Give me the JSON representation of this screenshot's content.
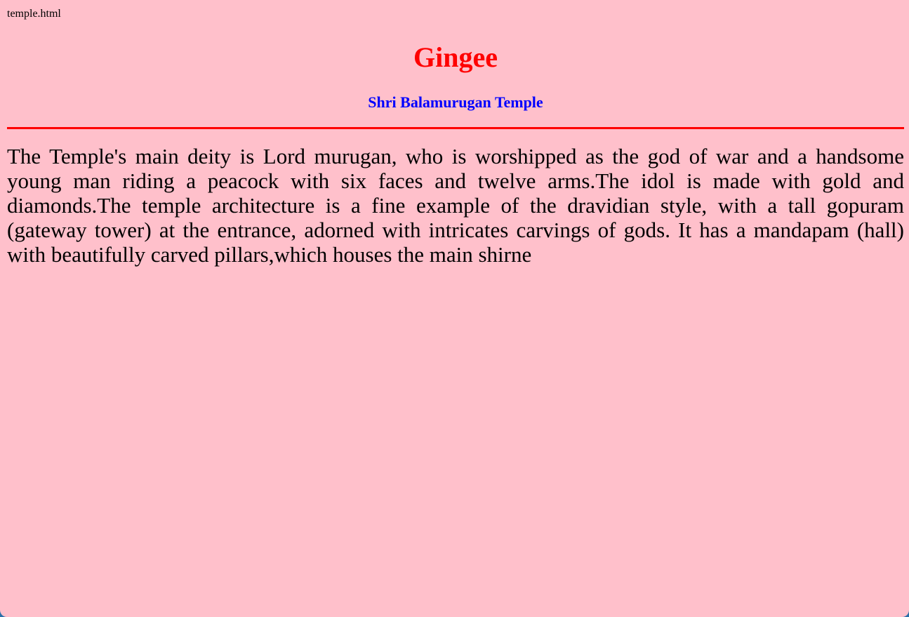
{
  "file_name": "temple.html",
  "heading": "Gingee",
  "subheading": "Shri Balamurugan Temple",
  "paragraph": "The Temple's main deity is Lord murugan, who is worshipped as the god of war and a handsome young man riding a peacock with six faces and twelve arms.The idol is made with gold and diamonds.The temple architecture is a fine example of the dravidian style, with a tall gopuram (gateway tower) at the entrance, adorned with intricates carvings of gods. It has a mandapam (hall) with beautifully carved pillars,which houses the main shirne",
  "colors": {
    "background": "#ffc0cb",
    "heading": "#ff0000",
    "subheading": "#0000ff",
    "divider": "#ff0000"
  }
}
